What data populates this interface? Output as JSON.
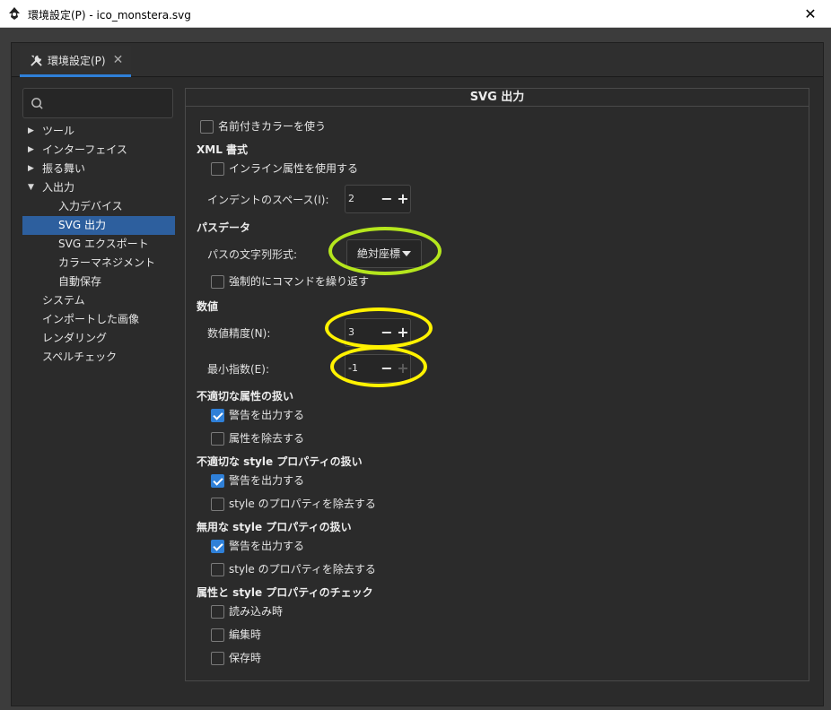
{
  "window": {
    "title": "環境設定(P) - ico_monstera.svg",
    "close_glyph": "✕"
  },
  "tab": {
    "label": "環境設定(P)",
    "close_glyph": "✕"
  },
  "search": {
    "placeholder": ""
  },
  "sidebar": {
    "items": [
      {
        "label": "ツール",
        "arrow": "▶"
      },
      {
        "label": "インターフェイス",
        "arrow": "▶"
      },
      {
        "label": "振る舞い",
        "arrow": "▶"
      },
      {
        "label": "入出力",
        "arrow": "▼"
      },
      {
        "label": "入力デバイス"
      },
      {
        "label": "SVG 出力"
      },
      {
        "label": "SVG エクスポート"
      },
      {
        "label": "カラーマネジメント"
      },
      {
        "label": "自動保存"
      },
      {
        "label": "システム"
      },
      {
        "label": "インポートした画像"
      },
      {
        "label": "レンダリング"
      },
      {
        "label": "スペルチェック"
      }
    ]
  },
  "panel": {
    "title": "SVG 出力",
    "named_colors": {
      "label": "名前付きカラーを使う",
      "checked": false
    },
    "xml_section": "XML 書式",
    "inline_attrs": {
      "label": "インライン属性を使用する",
      "checked": false
    },
    "indent": {
      "label": "インデントのスペース(I):",
      "value": "2",
      "minus": "−",
      "plus": "+"
    },
    "path_section": "パスデータ",
    "path_format": {
      "label": "パスの文字列形式:",
      "value": "絶対座標"
    },
    "force_repeat": {
      "label": "強制的にコマンドを繰り返す",
      "checked": false
    },
    "numeric_section": "数値",
    "precision": {
      "label": "数値精度(N):",
      "value": "3",
      "minus": "−",
      "plus": "+"
    },
    "min_exponent": {
      "label": "最小指数(E):",
      "value": "-1",
      "minus": "−",
      "plus": "+"
    },
    "bad_attr_section": "不適切な属性の扱い",
    "bad_attr_warn": {
      "label": "警告を出力する",
      "checked": true
    },
    "bad_attr_remove": {
      "label": "属性を除去する",
      "checked": false
    },
    "bad_style_section": "不適切な style プロパティの扱い",
    "bad_style_warn": {
      "label": "警告を出力する",
      "checked": true
    },
    "bad_style_remove": {
      "label": "style のプロパティを除去する",
      "checked": false
    },
    "useless_style_section": "無用な style プロパティの扱い",
    "useless_style_warn": {
      "label": "警告を出力する",
      "checked": true
    },
    "useless_style_remove": {
      "label": "style のプロパティを除去する",
      "checked": false
    },
    "check_section": "属性と style プロパティのチェック",
    "check_on_load": {
      "label": "読み込み時",
      "checked": false
    },
    "check_on_edit": {
      "label": "編集時",
      "checked": false
    },
    "check_on_save": {
      "label": "保存時",
      "checked": false
    }
  },
  "colors": {
    "accent": "#2f80d8",
    "selection": "#2d5f9e",
    "highlight_green": "#b5e61d",
    "highlight_yellow": "#fff200"
  },
  "icons": {
    "app": "inkscape-logo-icon",
    "tab": "tools-icon",
    "search": "search-icon"
  }
}
